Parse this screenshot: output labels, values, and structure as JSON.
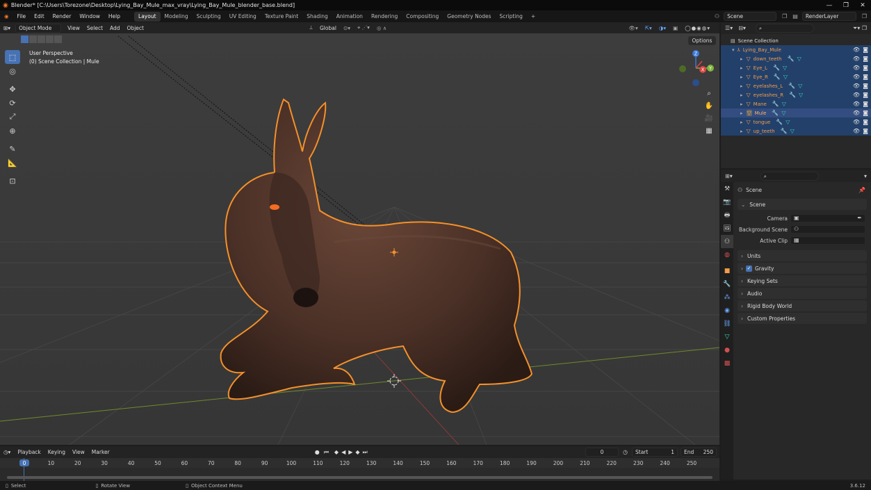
{
  "window": {
    "title": "Blender* [C:\\Users\\Torezone\\Desktop\\Lying_Bay_Mule_max_vray\\Lying_Bay_Mule_blender_base.blend]"
  },
  "menus": [
    "File",
    "Edit",
    "Render",
    "Window",
    "Help"
  ],
  "workspaces": [
    "Layout",
    "Modeling",
    "Sculpting",
    "UV Editing",
    "Texture Paint",
    "Shading",
    "Animation",
    "Rendering",
    "Compositing",
    "Geometry Nodes",
    "Scripting"
  ],
  "active_workspace": "Layout",
  "scene_field": "Scene",
  "view_layer_field": "RenderLayer",
  "viewport_header": {
    "mode": "Object Mode",
    "menus": [
      "View",
      "Select",
      "Add",
      "Object"
    ],
    "transform_orientation": "Global",
    "options_label": "Options"
  },
  "viewport": {
    "view_name": "User Perspective",
    "collection_info": "(0) Scene Collection | Mule",
    "gizmo_axes": [
      "Z",
      "Y",
      "X"
    ]
  },
  "outliner": {
    "root": "Scene Collection",
    "collection": "Lying_Bay_Mule",
    "items": [
      {
        "name": "down_teeth",
        "active": false
      },
      {
        "name": "Eye_L",
        "active": false
      },
      {
        "name": "Eye_R",
        "active": false
      },
      {
        "name": "eyelashes_L",
        "active": false
      },
      {
        "name": "eyelashes_R",
        "active": false
      },
      {
        "name": "Mane",
        "active": false
      },
      {
        "name": "Mule",
        "active": true
      },
      {
        "name": "tongue",
        "active": false
      },
      {
        "name": "up_teeth",
        "active": false
      }
    ]
  },
  "properties": {
    "context": "Scene",
    "section": "Scene",
    "fields": [
      {
        "label": "Camera",
        "value": ""
      },
      {
        "label": "Background Scene",
        "value": ""
      },
      {
        "label": "Active Clip",
        "value": ""
      }
    ],
    "panels": [
      "Units",
      "Gravity",
      "Keying Sets",
      "Audio",
      "Rigid Body World",
      "Custom Properties"
    ],
    "gravity_checked": true
  },
  "timeline": {
    "menus": [
      "Playback",
      "Keying",
      "View",
      "Marker"
    ],
    "current_frame": "0",
    "start_label": "Start",
    "start_value": "1",
    "end_label": "End",
    "end_value": "250",
    "ticks": [
      "0",
      "10",
      "20",
      "30",
      "40",
      "50",
      "60",
      "70",
      "80",
      "90",
      "100",
      "110",
      "120",
      "130",
      "140",
      "150",
      "160",
      "170",
      "180",
      "190",
      "200",
      "210",
      "220",
      "230",
      "240",
      "250"
    ]
  },
  "statusbar": {
    "select": "Select",
    "rotate": "Rotate View",
    "context_menu": "Object Context Menu",
    "version": "3.6.12"
  },
  "colors": {
    "accent": "#4772b3",
    "selection_outline": "#f5912a",
    "object_name": "#f39c4a"
  }
}
